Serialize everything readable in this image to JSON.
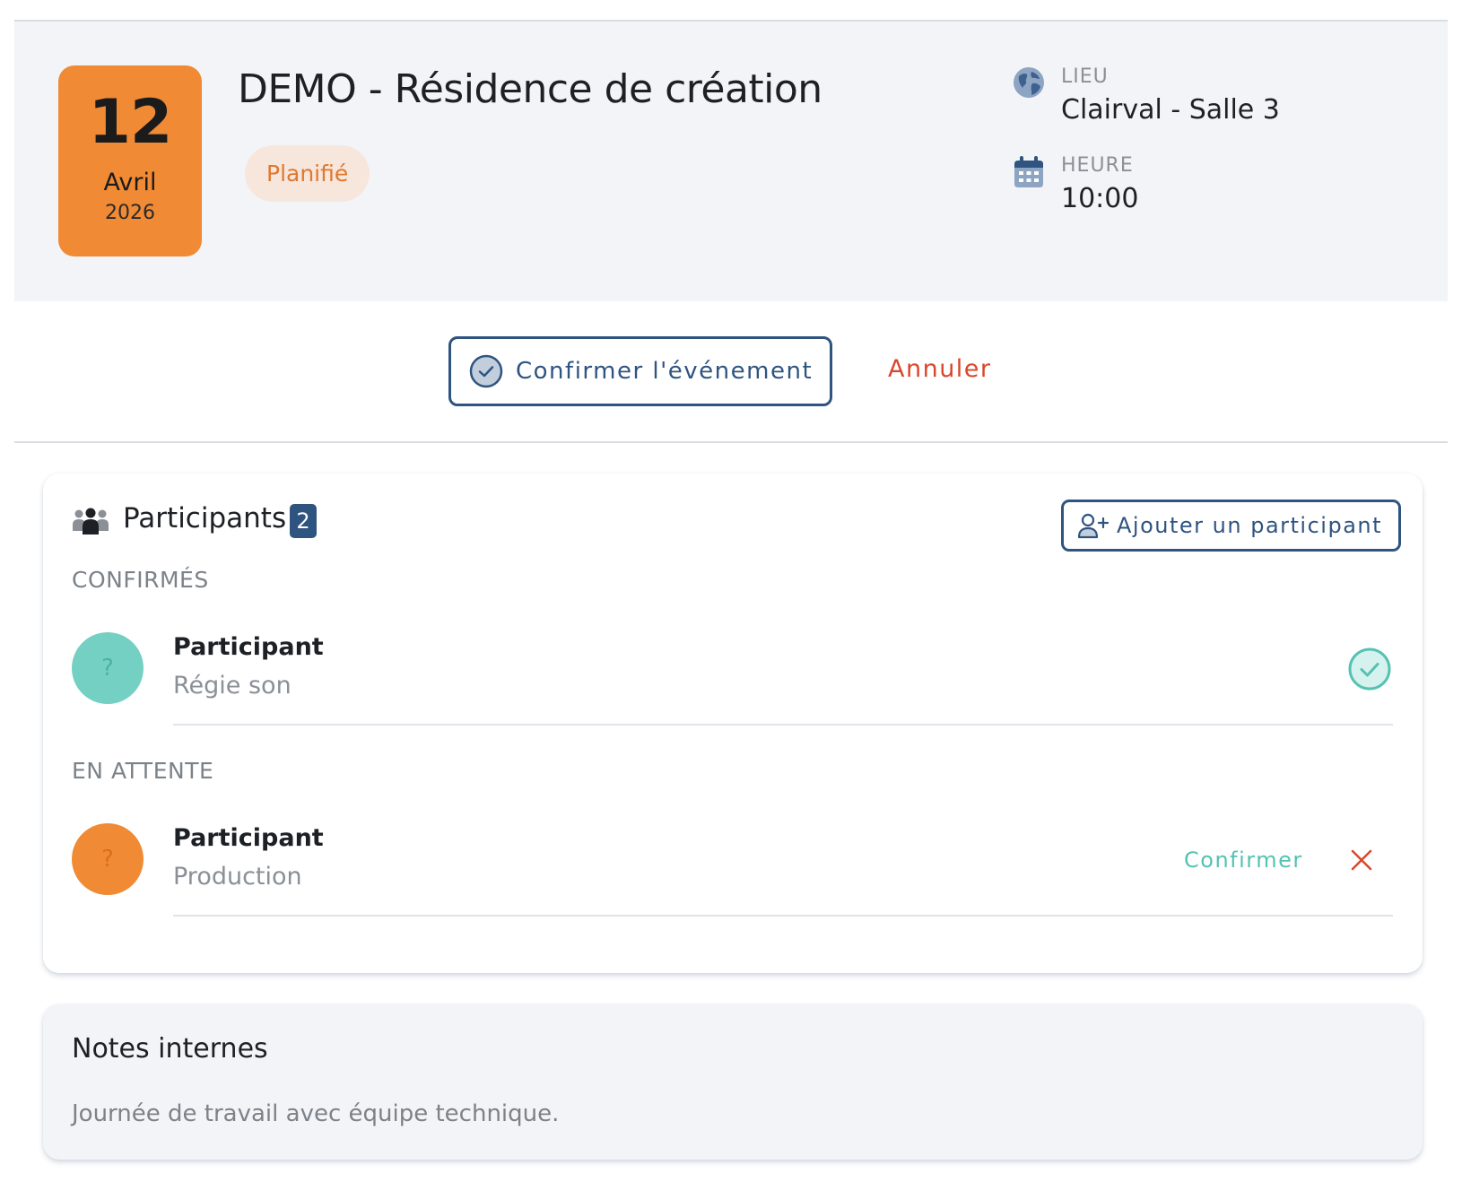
{
  "event": {
    "date": {
      "day": "12",
      "month": "Avril",
      "year": "2026"
    },
    "title": "DEMO - Résidence de création",
    "status": "Planifié",
    "location": {
      "label": "LIEU",
      "value": "Clairval - Salle 3",
      "icon": "globe-icon"
    },
    "time": {
      "label": "HEURE",
      "value": "10:00",
      "icon": "calendar-icon"
    }
  },
  "actions": {
    "confirm_event_label": "Confirmer l'événement",
    "cancel_label": "Annuler"
  },
  "participants": {
    "title": "Participants",
    "count": "2",
    "add_label": "Ajouter un participant",
    "confirmed_section": "CONFIRMÉS",
    "pending_section": "EN ATTENTE",
    "confirmed": [
      {
        "avatar": "?",
        "name": "Participant",
        "role": "Régie son"
      }
    ],
    "pending": [
      {
        "avatar": "?",
        "name": "Participant",
        "role": "Production",
        "confirm_label": "Confirmer"
      }
    ]
  },
  "notes": {
    "title": "Notes internes",
    "text": "Journée de travail avec équipe technique."
  },
  "colors": {
    "accent": "#2f5480",
    "date_badge": "#f08a34",
    "status_text": "#e0782e",
    "danger": "#d9472b",
    "success": "#55c2b2"
  }
}
